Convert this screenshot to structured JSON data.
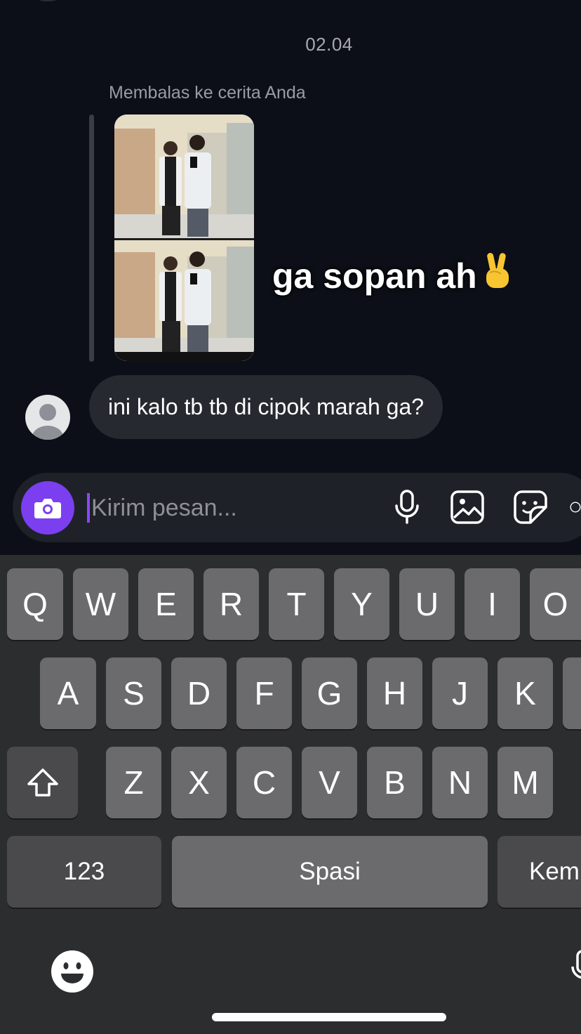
{
  "chat": {
    "timestamp": "02.04",
    "reply_label": "Membalas ke cerita Anda",
    "story_caption": "ga sopan ah",
    "message": "ini kalo tb tb di cipok marah ga?"
  },
  "composer": {
    "placeholder": "Kirim pesan...",
    "icons": [
      "camera-icon",
      "microphone-icon",
      "gallery-icon",
      "sticker-icon",
      "add-icon"
    ]
  },
  "keyboard": {
    "row1": [
      "Q",
      "W",
      "E",
      "R",
      "T",
      "Y",
      "U",
      "I",
      "O"
    ],
    "row2": [
      "A",
      "S",
      "D",
      "F",
      "G",
      "H",
      "J",
      "K"
    ],
    "row3": [
      "Z",
      "X",
      "C",
      "V",
      "B",
      "N",
      "M"
    ],
    "numbers_label": "123",
    "space_label": "Spasi",
    "return_label": "Kem"
  },
  "colors": {
    "background": "#0c0f17",
    "bubble": "#262930",
    "accent": "#7b3ff0",
    "keyboard": "#2c2d2f",
    "key": "#6b6b6d"
  }
}
